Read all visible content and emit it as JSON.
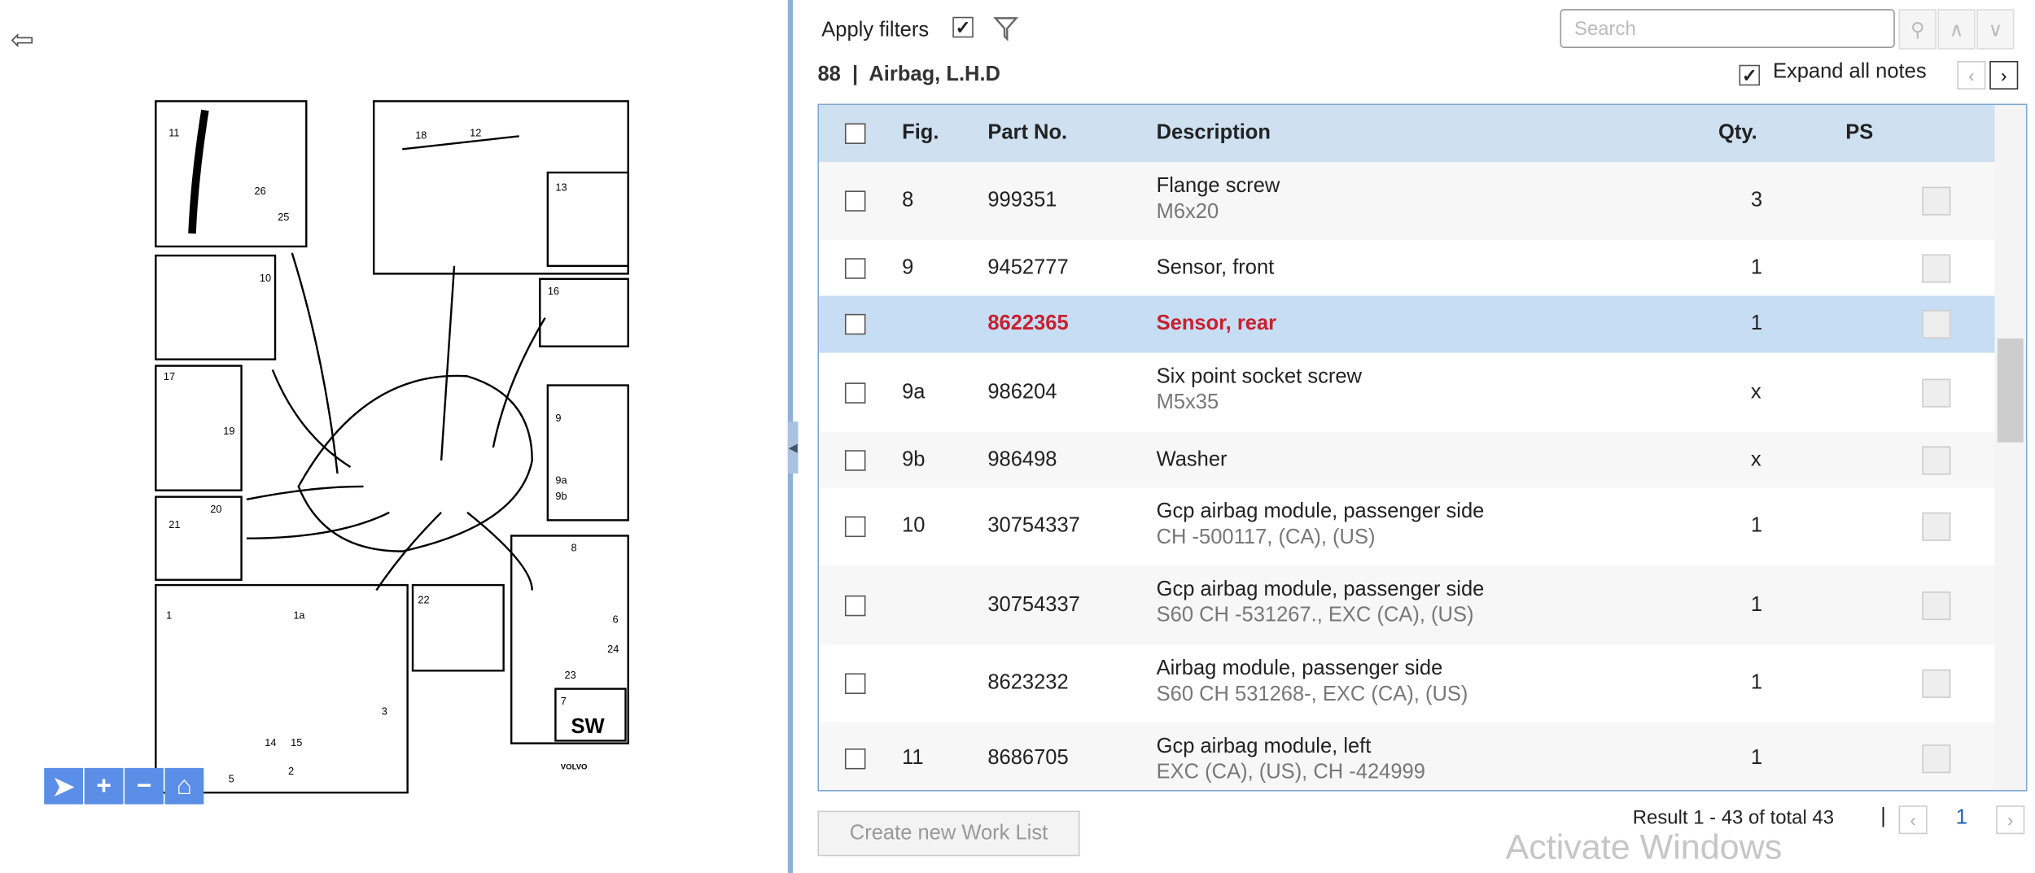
{
  "toolbar": {
    "apply_filters": "Apply filters",
    "search_placeholder": "Search",
    "expand_notes": "Expand all notes",
    "check": "✓"
  },
  "section": {
    "title": "88  |  Airbag, L.H.D"
  },
  "table": {
    "headers": {
      "fig": "Fig.",
      "part": "Part No.",
      "desc": "Description",
      "qty": "Qty.",
      "ps": "PS"
    },
    "rows": [
      {
        "fig": "8",
        "part": "999351",
        "desc": "Flange screw",
        "sub": "M6x20",
        "qty": "3"
      },
      {
        "fig": "9",
        "part": "9452777",
        "desc": "Sensor, front",
        "sub": "",
        "qty": "1"
      },
      {
        "fig": "",
        "part": "8622365",
        "desc": "Sensor, rear",
        "sub": "",
        "qty": "1"
      },
      {
        "fig": "9a",
        "part": "986204",
        "desc": "Six point socket screw",
        "sub": "M5x35",
        "qty": "x"
      },
      {
        "fig": "9b",
        "part": "986498",
        "desc": "Washer",
        "sub": "",
        "qty": "x"
      },
      {
        "fig": "10",
        "part": "30754337",
        "desc": "Gcp airbag module, passenger side",
        "sub": "CH -500117, (CA), (US)",
        "qty": "1"
      },
      {
        "fig": "",
        "part": "30754337",
        "desc": "Gcp airbag module, passenger side",
        "sub": "S60 CH -531267., EXC (CA), (US)",
        "qty": "1"
      },
      {
        "fig": "",
        "part": "8623232",
        "desc": "Airbag module, passenger side",
        "sub": "S60 CH 531268-, EXC (CA), (US)",
        "qty": "1"
      },
      {
        "fig": "11",
        "part": "8686705",
        "desc": "Gcp airbag module, left",
        "sub": "EXC (CA), (US), CH -424999",
        "qty": "1"
      }
    ]
  },
  "footer": {
    "create_button": "Create new Work List",
    "result": "Result 1 - 43 of total 43",
    "separator": "|",
    "page": "1",
    "watermark": "Activate Windows"
  },
  "diagram": {
    "labels": [
      "11",
      "26",
      "25",
      "18",
      "12",
      "13",
      "16",
      "10",
      "17",
      "19",
      "9",
      "9a",
      "9b",
      "20",
      "21",
      "8",
      "22",
      "6",
      "24",
      "23",
      "1",
      "1a",
      "14",
      "15",
      "5",
      "2",
      "3",
      "7",
      "SW",
      "VOLVO"
    ]
  }
}
